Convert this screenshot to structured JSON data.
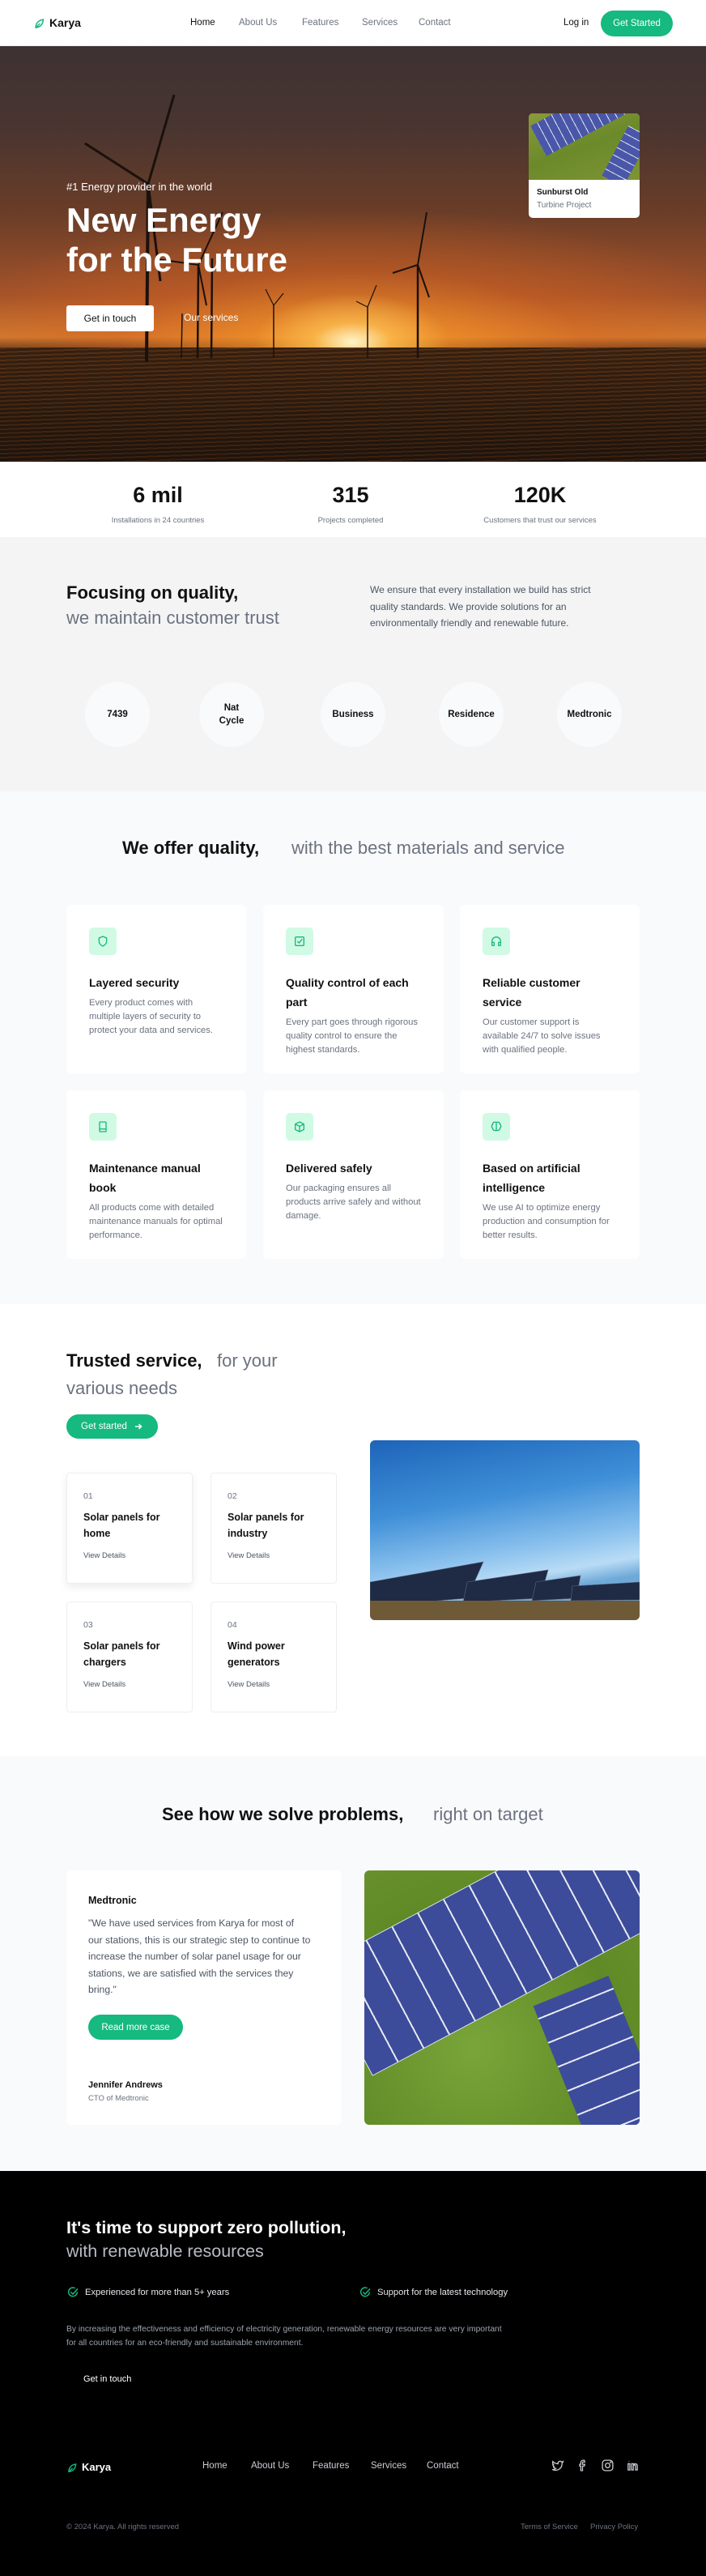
{
  "nav": {
    "brand": "Karya",
    "links": [
      "Home",
      "About Us",
      "Features",
      "Services",
      "Contact"
    ],
    "login": "Log in",
    "cta": "Get Started"
  },
  "hero": {
    "tagline": "#1 Energy provider in the world",
    "title_line1": "New Energy",
    "title_line2": "for the Future",
    "primary_button": "Get in touch",
    "secondary_button": "Our services",
    "card": {
      "title": "Sunburst Old",
      "subtitle": "Turbine Project"
    }
  },
  "stats": [
    {
      "value": "6 mil",
      "label": "Installations in 24 countries"
    },
    {
      "value": "315",
      "label": "Projects completed"
    },
    {
      "value": "120K",
      "label": "Customers that trust our services"
    }
  ],
  "quality": {
    "title_bold": "Focusing on quality,",
    "title_light": "we maintain customer trust",
    "description": "We ensure that every installation we build has strict quality standards. We provide solutions for an environmentally friendly and renewable future.",
    "clients": [
      "7439",
      "Nat Cycle",
      "Business",
      "Residence",
      "Medtronic"
    ]
  },
  "features": {
    "title_bold": "We offer quality,",
    "title_light": "with the best materials and service",
    "items": [
      {
        "icon": "shield-icon",
        "title": "Layered security",
        "description": "Every product comes with multiple layers of security to protect your data and services."
      },
      {
        "icon": "checkbox-icon",
        "title": "Quality control of each part",
        "description": "Every part goes through rigorous quality control to ensure the highest standards."
      },
      {
        "icon": "headphones-icon",
        "title": "Reliable customer service",
        "description": "Our customer support is available 24/7 to solve issues with qualified people."
      },
      {
        "icon": "book-icon",
        "title": "Maintenance manual book",
        "description": "All products come with detailed maintenance manuals for optimal performance."
      },
      {
        "icon": "package-icon",
        "title": "Delivered safely",
        "description": "Our packaging ensures all products arrive safely and without damage."
      },
      {
        "icon": "brain-icon",
        "title": "Based on artificial intelligence",
        "description": "We use AI to optimize energy production and consumption for better results."
      }
    ]
  },
  "services": {
    "title_bold": "Trusted service,",
    "title_light_1": "for your",
    "title_light_2": "various needs",
    "cta": "Get started",
    "items": [
      {
        "number": "01",
        "title": "Solar panels for home",
        "link": "View Details"
      },
      {
        "number": "02",
        "title": "Solar panels for industry",
        "link": "View Details"
      },
      {
        "number": "03",
        "title": "Solar panels for chargers",
        "link": "View Details"
      },
      {
        "number": "04",
        "title": "Wind power generators",
        "link": "View Details"
      }
    ]
  },
  "case": {
    "title_bold": "See how we solve problems,",
    "title_light": "right on target",
    "company": "Medtronic",
    "quote": "\"We have used services from Karya for most of our stations, this is our strategic step to continue to increase the number of solar panel usage for our stations, we are satisfied with the services they bring.\"",
    "button": "Read more case",
    "author": "Jennifer Andrews",
    "role": "CTO of Medtronic"
  },
  "cta": {
    "title_bold": "It's time to support zero pollution,",
    "title_light": "with renewable resources",
    "checks": [
      "Experienced for more than 5+ years",
      "Support for the latest technology"
    ],
    "description": "By increasing the effectiveness and efficiency of electricity generation, renewable energy resources are very important for all countries for an eco-friendly and sustainable environment.",
    "button": "Get in touch"
  },
  "footer": {
    "brand": "Karya",
    "links": [
      "Home",
      "About Us",
      "Features",
      "Services",
      "Contact"
    ],
    "social": [
      "twitter-icon",
      "facebook-icon",
      "instagram-icon",
      "linkedin-icon"
    ],
    "copyright": "© 2024 Karya. All rights reserved",
    "legal": [
      "Terms of Service",
      "Privacy Policy"
    ]
  },
  "colors": {
    "accent": "#16b97f",
    "dark": "#000000",
    "muted": "#6b7280"
  }
}
